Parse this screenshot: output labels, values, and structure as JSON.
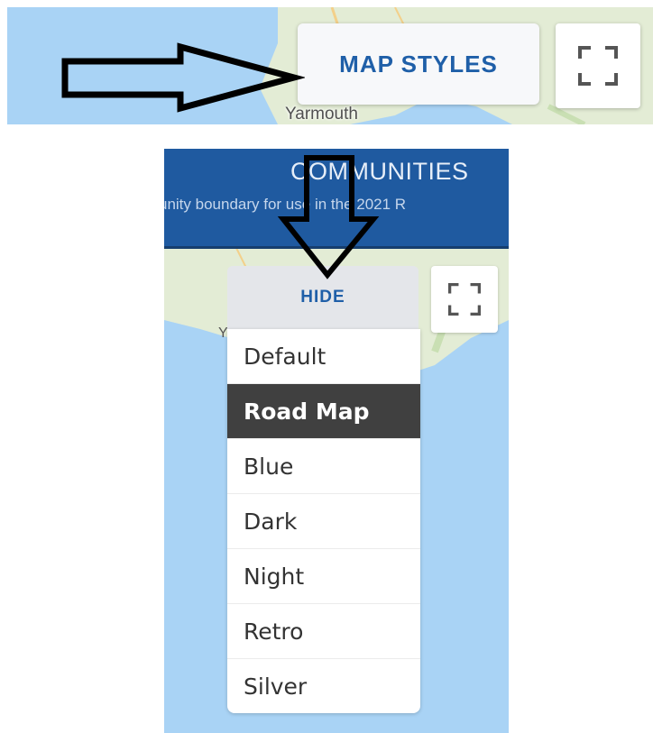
{
  "top_panel": {
    "map_styles_button": "MAP STYLES",
    "town_label": "Yarmouth",
    "fullscreen_icon": "fullscreen-icon",
    "annotation_icon": "arrow-right-icon"
  },
  "bottom_panel": {
    "header": {
      "title": "COMMUNITIES",
      "subtitle": "unity boundary for use in the 2021 R"
    },
    "hide_button": "HIDE",
    "town_label": "Y",
    "fullscreen_icon": "fullscreen-icon",
    "annotation_icon": "arrow-down-icon",
    "map_styles": [
      {
        "label": "Default",
        "selected": false
      },
      {
        "label": "Road Map",
        "selected": true
      },
      {
        "label": "Blue",
        "selected": false
      },
      {
        "label": "Dark",
        "selected": false
      },
      {
        "label": "Night",
        "selected": false
      },
      {
        "label": "Retro",
        "selected": false
      },
      {
        "label": "Silver",
        "selected": false
      }
    ]
  },
  "colors": {
    "accent_blue": "#1f5fa8",
    "header_blue": "#1f5aa0",
    "selected_bg": "#404040",
    "water": "#a9d3f5",
    "land": "#e3ecd5"
  }
}
